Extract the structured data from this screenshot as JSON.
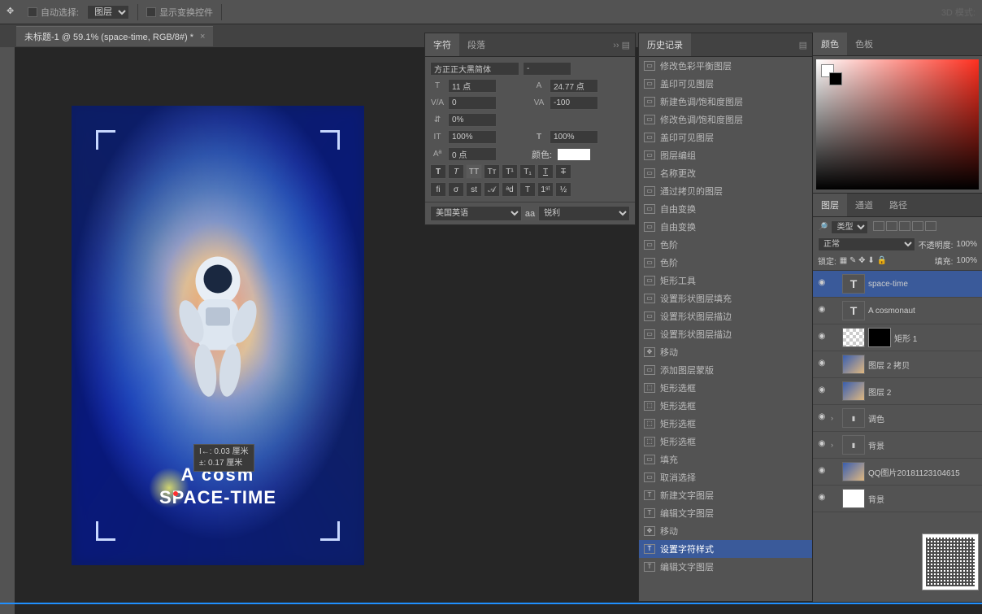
{
  "topbar": {
    "auto_select": "自动选择:",
    "layer_dropdown": "图层",
    "show_transform": "显示变换控件",
    "mode_3d": "3D 模式:"
  },
  "tab": {
    "title": "未标题-1 @ 59.1% (space-time, RGB/8#) *"
  },
  "char": {
    "tabs": {
      "char": "字符",
      "para": "段落"
    },
    "font": "方正正大黑简体",
    "style": "-",
    "size": "11 点",
    "leading": "24.77 点",
    "va": "0",
    "tracking": "-100",
    "scale": "0%",
    "vert": "100%",
    "horiz": "100%",
    "baseline": "0 点",
    "color_label": "颜色:",
    "lang": "美国英语",
    "aa": "aa",
    "sharp": "锐利"
  },
  "history": {
    "tab": "历史记录",
    "items": [
      {
        "icon": "▭",
        "label": "修改色彩平衡图层"
      },
      {
        "icon": "▭",
        "label": "盖印可见图层"
      },
      {
        "icon": "▭",
        "label": "新建色调/饱和度图层"
      },
      {
        "icon": "▭",
        "label": "修改色调/饱和度图层"
      },
      {
        "icon": "▭",
        "label": "盖印可见图层"
      },
      {
        "icon": "▭",
        "label": "图层编组"
      },
      {
        "icon": "▭",
        "label": "名称更改"
      },
      {
        "icon": "▭",
        "label": "通过拷贝的图层"
      },
      {
        "icon": "▭",
        "label": "自由变换"
      },
      {
        "icon": "▭",
        "label": "自由变换"
      },
      {
        "icon": "▭",
        "label": "色阶"
      },
      {
        "icon": "▭",
        "label": "色阶"
      },
      {
        "icon": "▭",
        "label": "矩形工具"
      },
      {
        "icon": "▭",
        "label": "设置形状图层填充"
      },
      {
        "icon": "▭",
        "label": "设置形状图层描边"
      },
      {
        "icon": "▭",
        "label": "设置形状图层描边"
      },
      {
        "icon": "✥",
        "label": "移动"
      },
      {
        "icon": "▭",
        "label": "添加图层蒙版"
      },
      {
        "icon": "⬚",
        "label": "矩形选框"
      },
      {
        "icon": "⬚",
        "label": "矩形选框"
      },
      {
        "icon": "⬚",
        "label": "矩形选框"
      },
      {
        "icon": "⬚",
        "label": "矩形选框"
      },
      {
        "icon": "▭",
        "label": "填充"
      },
      {
        "icon": "▭",
        "label": "取消选择"
      },
      {
        "icon": "T",
        "label": "新建文字图层"
      },
      {
        "icon": "T",
        "label": "编辑文字图层"
      },
      {
        "icon": "✥",
        "label": "移动"
      },
      {
        "icon": "T",
        "label": "设置字符样式",
        "sel": true
      },
      {
        "icon": "T",
        "label": "编辑文字图层"
      }
    ]
  },
  "color": {
    "tab1": "颜色",
    "tab2": "色板"
  },
  "layers": {
    "tabs": {
      "layer": "图层",
      "channel": "通道",
      "path": "路径"
    },
    "kind": "类型",
    "blend": "正常",
    "opacity_lbl": "不透明度:",
    "opacity": "100%",
    "lock_lbl": "锁定:",
    "fill_lbl": "填充:",
    "fill": "100%",
    "items": [
      {
        "eye": "◉",
        "thumb": "t-text",
        "tcontent": "T",
        "name": "space-time",
        "sel": true
      },
      {
        "eye": "◉",
        "thumb": "t-text",
        "tcontent": "T",
        "name": "A  cosmonaut"
      },
      {
        "eye": "◉",
        "thumb": "t-trans",
        "tcontent": "",
        "name": "矩形 1",
        "extra": "black"
      },
      {
        "eye": "◉",
        "thumb": "t-img",
        "tcontent": "",
        "name": "图层 2 拷贝"
      },
      {
        "eye": "◉",
        "thumb": "t-img",
        "tcontent": "",
        "name": "图层 2"
      },
      {
        "eye": "◉",
        "chev": "›",
        "thumb": "t-folder",
        "tcontent": "▮",
        "name": "调色"
      },
      {
        "eye": "◉",
        "chev": "›",
        "thumb": "t-folder",
        "tcontent": "▮",
        "name": "背景"
      },
      {
        "eye": "◉",
        "thumb": "t-img",
        "tcontent": "",
        "name": "QQ图片20181123104615"
      },
      {
        "eye": "◉",
        "thumb": "t-white",
        "tcontent": "",
        "name": "背景"
      }
    ]
  },
  "poster": {
    "line1": "A  cosm",
    "line2": "SPACE-TIME",
    "meas1": "I←: 0.03 厘米",
    "meas2": "±: 0.17 厘米"
  }
}
